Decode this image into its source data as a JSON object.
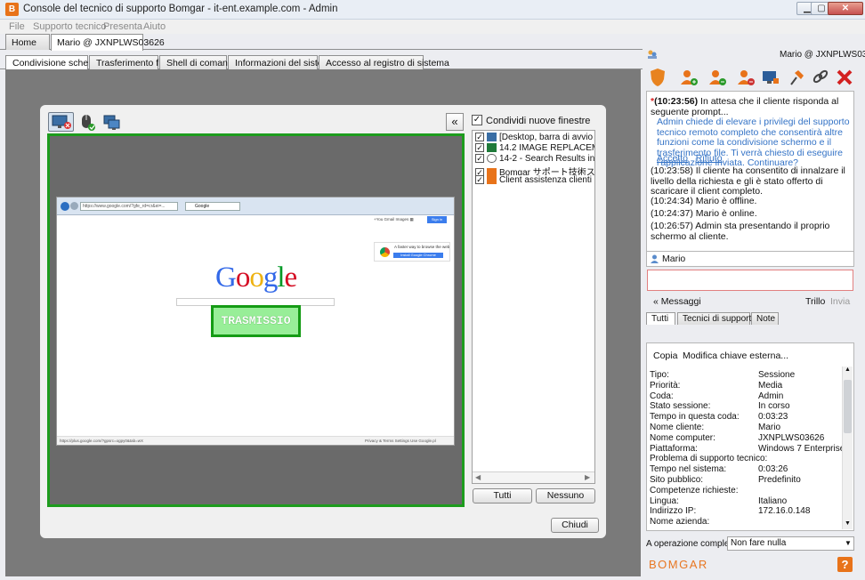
{
  "window": {
    "title": "Console del tecnico di supporto Bomgar - it-ent.example.com - Admin",
    "minimize": "▁",
    "maximize": "▢",
    "close": "✕"
  },
  "menu": [
    "File",
    "Supporto tecnico",
    "Presenta",
    "Aiuto"
  ],
  "session_tabs": [
    "Home",
    "Mario @ JXNPLWS03626"
  ],
  "inner_tabs": [
    "Condivisione schermo",
    "Trasferimento file",
    "Shell di comando",
    "Informazioni del sistema",
    "Accesso al registro di sistema"
  ],
  "screen_share": {
    "collapse": "«",
    "share_new_windows": "Condividi nuove finestre",
    "overlay_text": "TRASMISSIO",
    "windows": [
      {
        "label": "[Desktop, barra di avvio e v",
        "icon": "desktop-icon"
      },
      {
        "label": "14.2 IMAGE REPLACEMENT",
        "icon": "excel-icon"
      },
      {
        "label": "14-2 - Search Results in ent",
        "icon": "search-icon"
      },
      {
        "label": "Bomgar サポート技術スタッフ",
        "icon": "bomgar-icon"
      },
      {
        "label": "Client assistenza clienti Bor",
        "icon": "bomgar-icon"
      }
    ],
    "all_button": "Tutti",
    "none_button": "Nessuno",
    "close_button": "Chiudi",
    "remote": {
      "url": "https://www.google.com/?gfe_rd=cr&ei=...",
      "tab_title": "Google",
      "logo": "Google",
      "gbar_links": "+You  Gmail  Images   ▦",
      "sign_in": "Sign in",
      "chrome_text": "A faster way to browse the web",
      "chrome_button": "Install Google Chrome",
      "footer_left": "https://plus.google.com/?gpsrc=ogpy0&tab=wX",
      "footer_right": "Privacy & Terms     Settings     Use Google.pl"
    }
  },
  "right": {
    "session_user": "Mario @ JXNPLWS03626",
    "chat": {
      "prompt_time": "(10:23:56)",
      "prompt_text": "In attesa che il cliente risponda al seguente prompt...",
      "request_text": "Admin chiede di elevare i privilegi del supporto tecnico remoto completo che consentirà altre funzioni come la condivisione schermo e il trasferimento file. Ti verrà chiesto di eseguire l'applicazione inviata. Continuare?",
      "accept": "Accetto",
      "refuse": "Rifiuto",
      "messages": [
        "(10:23:58) Il cliente ha consentito di innalzare il livello della richiesta e gli è stato offerto di scaricare il client completo.",
        "(10:24:34) Mario è offline.",
        "(10:24:37) Mario è online.",
        "(10:26:57) Admin sta presentando il proprio schermo al cliente."
      ]
    },
    "chat_user": "Mario",
    "messages_toggle": "« Messaggi",
    "trillo": "Trillo",
    "send": "Invia",
    "tabs": [
      "Tutti",
      "Tecnici di supporto",
      "Note"
    ],
    "copy": "Copia",
    "edit_external_key": "Modifica chiave esterna...",
    "info": [
      [
        "Tipo:",
        "Sessione"
      ],
      [
        "Priorità:",
        "Media"
      ],
      [
        "Coda:",
        "Admin"
      ],
      [
        "Stato sessione:",
        "In corso"
      ],
      [
        "Tempo in questa coda:",
        "0:03:23"
      ],
      [
        "Nome cliente:",
        "Mario"
      ],
      [
        "Nome computer:",
        "JXNPLWS03626"
      ],
      [
        "Piattaforma:",
        "Windows 7 Enterprise..."
      ],
      [
        "Problema di supporto tecnico:",
        ""
      ],
      [
        "Tempo nel sistema:",
        "0:03:26"
      ],
      [
        "Sito pubblico:",
        "Predefinito"
      ],
      [
        "Competenze richieste:",
        ""
      ],
      [
        "Lingua:",
        "Italiano"
      ],
      [
        "Indirizzo IP:",
        "172.16.0.148"
      ],
      [
        "Nome azienda:",
        ""
      ]
    ],
    "completion_label": "A operazione completata",
    "completion_value": "Non fare nulla",
    "logo": "BOMGAR",
    "help": "?"
  }
}
